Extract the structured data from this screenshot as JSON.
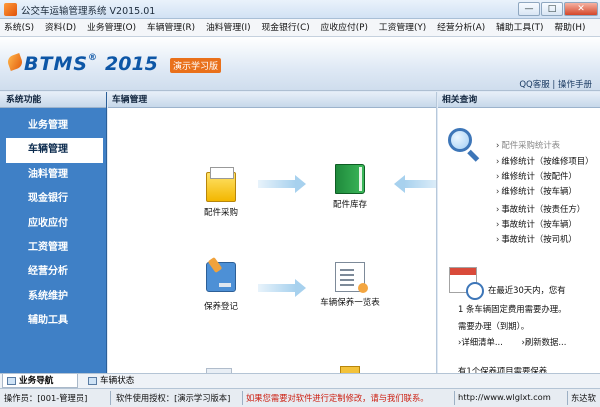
{
  "window": {
    "title": "公交车运输管理系统 V2015.01",
    "controls": {
      "minimize": "—",
      "maximize": "□",
      "close": "✕"
    }
  },
  "menu": [
    "系统(S)",
    "资料(D)",
    "业务管理(O)",
    "车辆管理(R)",
    "油料管理(I)",
    "现金银行(C)",
    "应收应付(P)",
    "工资管理(Y)",
    "经营分析(A)",
    "辅助工具(T)",
    "帮助(H)"
  ],
  "banner": {
    "logo": "BTMS",
    "year": "2015",
    "badge": "演示学习版",
    "links": {
      "qq": "QQ客服",
      "sep": "|",
      "manual": "操作手册"
    }
  },
  "leftnav": {
    "header": "系统功能",
    "items": [
      "业务管理",
      "车辆管理",
      "油料管理",
      "现金银行",
      "应收应付",
      "工资管理",
      "经营分析",
      "系统维护",
      "辅助工具"
    ],
    "active_index": 1
  },
  "main": {
    "header": "车辆管理",
    "tiles": {
      "parts_purchase": "配件采购",
      "parts_stock": "配件库存",
      "maintenance_register": "保养登记",
      "maintenance_list": "车辆保养一览表"
    }
  },
  "right": {
    "header": "相关查询",
    "links": [
      "配件采购统计表",
      "维修统计（按维修项目）",
      "维修统计（按配件）",
      "维修统计（按车辆）",
      "事故统计（按责任方）",
      "事故统计（按车辆）",
      "事故统计（按司机）"
    ],
    "notice": {
      "line1": "在最近30天内，您有",
      "line2": "1 条车辆固定费用需要办理。",
      "line3": "需要办理（到期）。",
      "detail": "详细清单...",
      "refresh": "刷新数据...",
      "line4": "有1个保养项目需要保养"
    }
  },
  "bottom_tabs": [
    "业务导航",
    "车辆状态"
  ],
  "status": {
    "operator": "操作员：[001-管理员]",
    "license": "软件使用授权：[演示学习版本]",
    "message": "如果您需要对软件进行定制修改，请与我们联系。",
    "website": "http://www.wlglxt.com",
    "company": "东达软"
  }
}
